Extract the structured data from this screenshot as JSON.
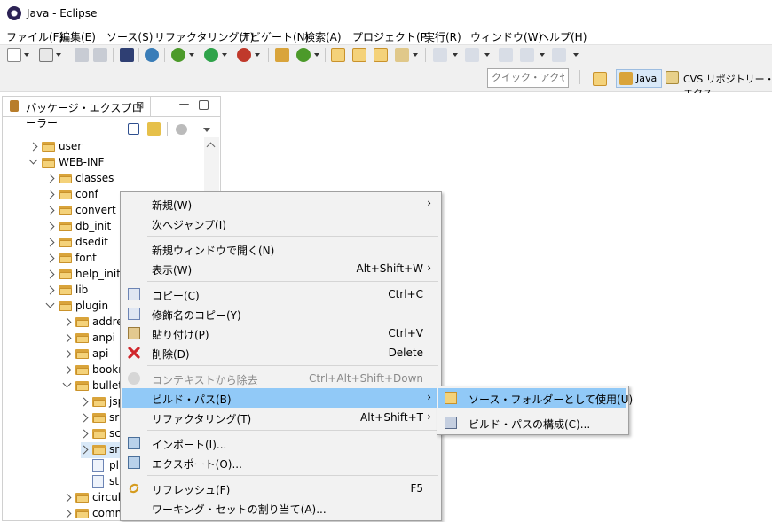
{
  "window": {
    "title": "Java - Eclipse"
  },
  "menu": [
    "ファイル(F)",
    "編集(E)",
    "ソース(S)",
    "リファクタリング(T)",
    "ナビゲート(N)",
    "検索(A)",
    "プロジェクト(P)",
    "実行(R)",
    "ウィンドウ(W)",
    "ヘルプ(H)"
  ],
  "quick_access": {
    "placeholder": "クイック・アクセス"
  },
  "perspectives": {
    "java": "Java",
    "cvs": "CVS リポジトリー・エクス"
  },
  "package_explorer": {
    "tab_label": "パッケージ・エクスプローラー",
    "close_glyph": "⊠",
    "items": [
      "user",
      "WEB-INF",
      "classes",
      "conf",
      "convert",
      "db_init",
      "dsedit",
      "font",
      "help_init",
      "lib",
      "plugin",
      "addre",
      "anpi",
      "api",
      "bookr",
      "bullet",
      "jsp",
      "sr",
      "sc",
      "sr",
      "pl",
      "st",
      "circul",
      "comm"
    ]
  },
  "context_menu": {
    "items": [
      {
        "label": "新規(W)",
        "shortcut": "",
        "arrow": "›"
      },
      {
        "label": "次へジャンプ(I)",
        "shortcut": "",
        "arrow": ""
      },
      {
        "label": "新規ウィンドウで開く(N)",
        "shortcut": "",
        "arrow": ""
      },
      {
        "label": "表示(W)",
        "shortcut": "Alt+Shift+W",
        "arrow": "›"
      },
      {
        "label": "コピー(C)",
        "shortcut": "Ctrl+C",
        "arrow": ""
      },
      {
        "label": "修飾名のコピー(Y)",
        "shortcut": "",
        "arrow": ""
      },
      {
        "label": "貼り付け(P)",
        "shortcut": "Ctrl+V",
        "arrow": ""
      },
      {
        "label": "削除(D)",
        "shortcut": "Delete",
        "arrow": ""
      },
      {
        "label": "コンテキストから除去",
        "shortcut": "Ctrl+Alt+Shift+Down",
        "arrow": ""
      },
      {
        "label": "ビルド・パス(B)",
        "shortcut": "",
        "arrow": "›"
      },
      {
        "label": "リファクタリング(T)",
        "shortcut": "Alt+Shift+T",
        "arrow": "›"
      },
      {
        "label": "インポート(I)...",
        "shortcut": "",
        "arrow": ""
      },
      {
        "label": "エクスポート(O)...",
        "shortcut": "",
        "arrow": ""
      },
      {
        "label": "リフレッシュ(F)",
        "shortcut": "F5",
        "arrow": ""
      },
      {
        "label": "ワーキング・セットの割り当て(A)...",
        "shortcut": "",
        "arrow": ""
      }
    ]
  },
  "submenu": {
    "items": [
      {
        "label": "ソース・フォルダーとして使用(U)"
      },
      {
        "label": "ビルド・パスの構成(C)..."
      }
    ]
  },
  "colors": {
    "highlight": "#91c9f7",
    "menu_bg": "#f2f2f2",
    "folder": "#f4d27a"
  }
}
